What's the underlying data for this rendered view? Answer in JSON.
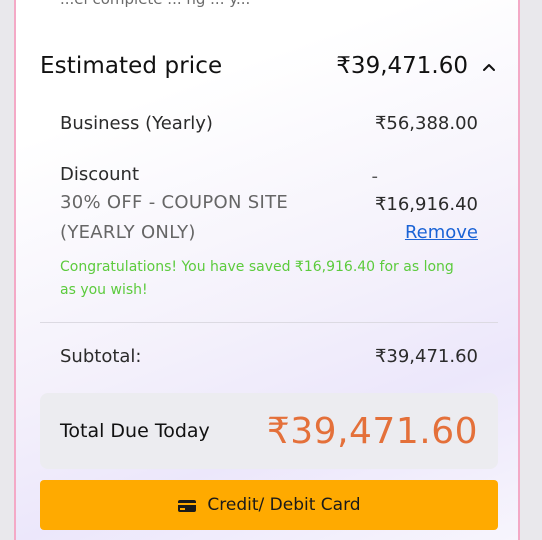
{
  "top_partial_text": "...el complete ... ng ... y...",
  "estimated_price": {
    "title": "Estimated price",
    "amount": "₹39,471.60",
    "expanded": true
  },
  "plan": {
    "label": "Business (Yearly)",
    "amount": "₹56,388.00"
  },
  "discount": {
    "title": "Discount",
    "description": "30% OFF - COUPON SITE (YEARLY ONLY)",
    "dash": "-",
    "amount": "₹16,916.40",
    "remove_label": "Remove",
    "congrats": "Congratulations! You have saved ₹16,916.40 for as long as you wish!"
  },
  "subtotal": {
    "label": "Subtotal:",
    "amount": "₹39,471.60"
  },
  "total": {
    "label": "Total Due Today",
    "amount": "₹39,471.60"
  },
  "pay_button": {
    "label": "Credit/ Debit Card",
    "icon": "credit-card-icon"
  },
  "colors": {
    "accent_orange": "#e4703a",
    "button_yellow": "#ffaa00",
    "link_blue": "#1a63d6",
    "success_green": "#5ccb3d",
    "frame_pink": "#f4a9c6"
  }
}
